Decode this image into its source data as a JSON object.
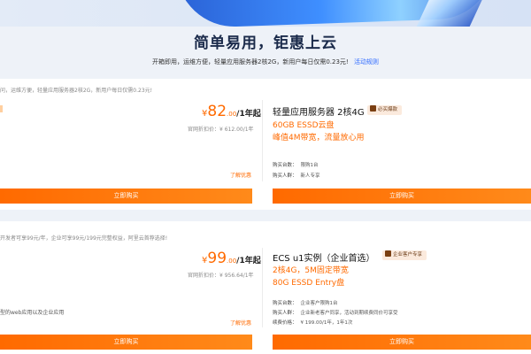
{
  "banner": {
    "headline": "简单易用，钜惠上云",
    "subline": "开箱即用，运维方便，轻量应用服务器2核2G，新用户每日仅需0.23元!",
    "rule_link": "活动规则"
  },
  "section1": {
    "note": "问，运维方便，轻量应用服务器2核2G，新用户每日仅需0.23元!",
    "left": {
      "price_symbol": "¥",
      "price": "82",
      "price_unit": ".00",
      "period": "/1年起",
      "original": "官网折扣价：¥ 612.00/1年",
      "coupon": "了解优惠",
      "buy": "立即购买"
    },
    "right": {
      "title": "轻量应用服务器 2核4G",
      "badge": "必买爆款",
      "spec1": "60GB ESSD云盘",
      "spec2": "峰值4M带宽，流量放心用",
      "meta1_k": "购买台数：",
      "meta1_v": "限购1台",
      "meta2_k": "购买人群：",
      "meta2_v": "新人专享",
      "buy": "立即购买"
    }
  },
  "section2": {
    "note": "开发者可享99元/年，企业可享99元/199元完整权益，阿里云首荐选择!",
    "left": {
      "price_symbol": "¥",
      "price": "99",
      "price_unit": ".00",
      "period": "/1年起",
      "original": "官网折扣价：¥ 956.64/1年",
      "feature": "型的web应用以及企业应用",
      "coupon": "了解优惠",
      "buy": "立即购买"
    },
    "right": {
      "title": "ECS u1实例（企业首选）",
      "badge": "企业客户专享",
      "spec1": "2核4G，5M固定带宽",
      "spec2": "80G ESSD Entry盘",
      "meta1_k": "购买台数：",
      "meta1_v": "企业客户限购1台",
      "meta2_k": "购买人群：",
      "meta2_v": "企业新老客户同享，活动到期续费同价可享受",
      "meta3_k": "续费价格：",
      "meta3_v": "¥ 199.00/1年，1年1次",
      "buy": "立即购买"
    }
  },
  "colors": {
    "accent": "#ff6a00",
    "link": "#2f6bff",
    "badge_bg": "#fbeadd"
  }
}
